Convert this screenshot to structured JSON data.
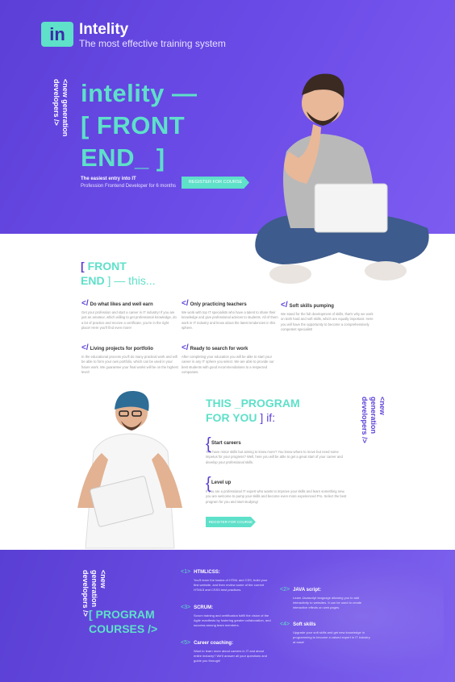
{
  "header": {
    "logo": "in",
    "brand": "Intelity",
    "tagline": "The most effective training system"
  },
  "hero": {
    "vertical": "<new generation developers />",
    "title_lines": [
      "intelity —",
      "[ FRONT",
      "END_ ]"
    ],
    "subtitle": "The easiest entry into IT",
    "subtitle2": "Profession Frontend Developer for 6 months",
    "button": "REGISTER FOR COURSE"
  },
  "features": {
    "title_line1_br": "[",
    "title_line1": "FRONT",
    "title_line2": "END",
    "title_line2_rest": "] — this...",
    "items": [
      {
        "title": "Do what likes and well earn",
        "desc": "Get your profession and start a career in IT industry! If you are just an amateur, which willing to get professional knowledge, do a lot of practice and receive a certificate, you're in the right place! Here you'll find even more!"
      },
      {
        "title": "Only practicing teachers",
        "desc": "We work with top IT specialists who have a talent to share their knowledge and give professional advices to students. All of them work in IT industry and know about the latest tendencies in this sphere."
      },
      {
        "title": "Soft skills pumping",
        "desc": "We stand for the full development of skills, that's why we work on both hard and soft skills, which are equally important. Here you will have the opportunity to become a comprehensively competent specialist!"
      },
      {
        "title": "Living projects for portfolio",
        "desc": "In the educational process you'll do many practical work and will be able to form your own portfolio, which can be used in your future work. We guarantee your final works will be on the highest level!"
      },
      {
        "title": "Ready to search for work",
        "desc": "After completing your education you will be able to start your career in any IT sphere you select. We are able to provide our best students with good recommendations to a respected companies."
      }
    ]
  },
  "program": {
    "title_l1": "THIS _PROGRAM",
    "title_l2": "FOR YOU",
    "title_l2_rest": "] if:",
    "vertical": "<new generation developers />",
    "items": [
      {
        "title": "Start careers",
        "desc": "You have minor skills but aiming to know more? You know where to move but need some impetus for your progress? Well, here you will be able to get a great start of your career and develop your professional skills."
      },
      {
        "title": "Level up",
        "desc": "If you are a professional IT expert who wants to improve your skills and learn something new, you are welcome to pump your skills and become even more experienced Pro. Select the best program for you and start studying!"
      }
    ],
    "button": "REGISTER FOR COURSE"
  },
  "courses": {
    "vertical": "<new generation developers />",
    "title_l1": "[ PROGRAM",
    "title_l2": "COURSES />",
    "items": [
      {
        "num": "<1>",
        "title": "HTML\\CSS:",
        "desc": "You'll learn the basics of HTML and CSS, build your first website, and then review some of the current HTML5 and CSS3 best practices."
      },
      {
        "num": "<2>",
        "title": "JAVA script:",
        "desc": "Learn Javascript language allowing you to add interactivity to websites. It can be used to create interactive effects on web pages."
      },
      {
        "num": "<3>",
        "title": "SCRUM:",
        "desc": "Scrum training and certification fulfill the vision of the Agile manifesto by fostering greater collaboration, and success among team members."
      },
      {
        "num": "<4>",
        "title": "Soft skills",
        "desc": "Upgrade your soft skills and get new knowledge in programming to become a valued expert in IT industry at ease!"
      },
      {
        "num": "<5>",
        "title": "Career coaching:",
        "desc": "Want to learn more about careers in IT and about entire industry? We'll answer all your questions and guide you through!"
      }
    ]
  },
  "colors": {
    "accent": "#5ee0c9",
    "primary": "#5b3fd6"
  }
}
